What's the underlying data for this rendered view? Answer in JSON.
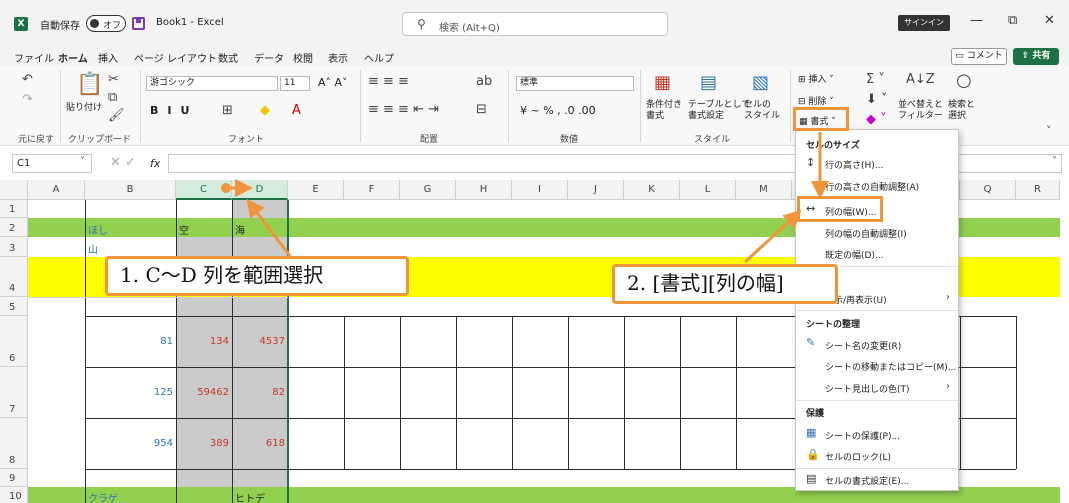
{
  "titlebar": {
    "app_logo": "X",
    "autosave_label": "自動保存",
    "autosave_state": "オフ",
    "document_title": "Book1  -  Excel",
    "search_placeholder": "検索 (Alt+Q)",
    "signin_label": "サインイン",
    "minimize": "—",
    "restore": "⧉",
    "close": "✕"
  },
  "menubar": {
    "items": [
      "ファイル",
      "ホーム",
      "挿入",
      "ページ レイアウト",
      "数式",
      "データ",
      "校閲",
      "表示",
      "ヘルプ"
    ],
    "active": "ホーム",
    "comment_label": "コメント",
    "share_label": "共有"
  },
  "ribbon": {
    "undo_group": "元に戻す",
    "clipboard_group": "クリップボード",
    "paste_label": "貼り付け",
    "font_group": "フォント",
    "font_name": "游ゴシック",
    "font_size": "11",
    "align_group": "配置",
    "number_group": "数値",
    "number_format": "標準",
    "style_group": "スタイル",
    "conditional_format": "条件付き\n書式",
    "table_format": "テーブルとして\n書式設定",
    "cell_style": "セルの\nスタイル",
    "insert_label": "挿入",
    "delete_label": "削除",
    "format_label": "書式",
    "sort_filter": "並べ替えと\nフィルター",
    "find_select": "検索と\n選択"
  },
  "formula_bar": {
    "name_box": "C1",
    "fx": "fx"
  },
  "grid": {
    "columns": [
      "A",
      "B",
      "C",
      "D",
      "E",
      "F",
      "G",
      "H",
      "I",
      "J",
      "K",
      "L",
      "M",
      "N",
      "O",
      "P",
      "Q",
      "R"
    ],
    "rows": [
      "1",
      "2",
      "3",
      "4",
      "5",
      "6",
      "7",
      "8",
      "9",
      "10"
    ],
    "cells": {
      "b2": "ほし",
      "c2": "空",
      "d2": "海",
      "b3": "山",
      "b6": "81",
      "c6": "134",
      "d6": "4537",
      "b7": "125",
      "c7": "59462",
      "d7": "82",
      "b8": "954",
      "c8": "389",
      "d8": "618",
      "b10": "クラゲ",
      "d10": "ヒトデ"
    }
  },
  "format_menu": {
    "section_cell_size": "セルのサイズ",
    "row_height": "行の高さ(H)...",
    "autofit_row": "行の高さの自動調整(A)",
    "column_width": "列の幅(W)...",
    "autofit_column": "列の幅の自動調整(I)",
    "default_width": "既定の幅(D)...",
    "hide_unhide": "表示/再表示(U)",
    "section_organize": "シートの整理",
    "rename_sheet": "シート名の変更(R)",
    "move_copy": "シートの移動またはコピー(M)...",
    "tab_color": "シート見出しの色(T)",
    "section_protect": "保護",
    "protect_sheet": "シートの保護(P)...",
    "lock_cell": "セルのロック(L)",
    "format_cells": "セルの書式設定(E)..."
  },
  "annotations": {
    "step1": "1.  C～D 列を範囲選択",
    "step2": "2.  [書式][列の幅]"
  },
  "colors": {
    "excel_green": "#1e7145",
    "annotation_orange": "#f0953c",
    "band_green": "#92d050",
    "band_yellow": "#ffff00"
  }
}
